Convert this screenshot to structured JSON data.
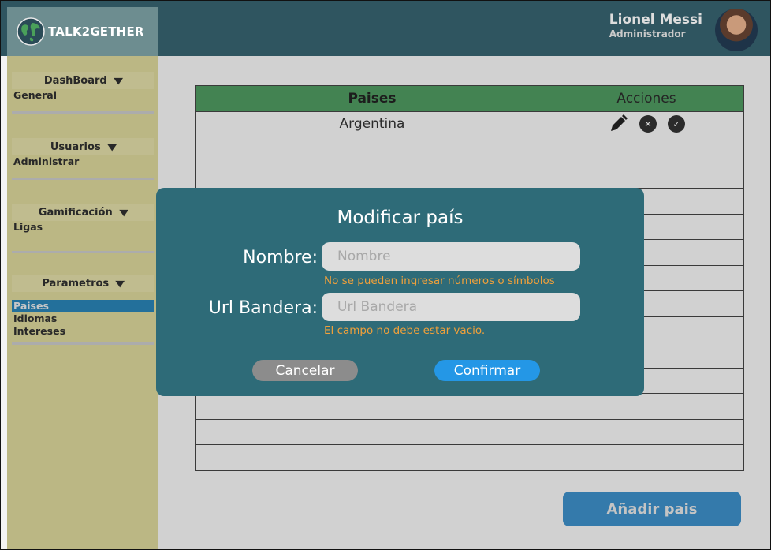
{
  "app": {
    "logo_text": "TALK2GETHER"
  },
  "user": {
    "name": "Lionel Messi",
    "role": "Administrador"
  },
  "sidebar": {
    "sections": [
      {
        "title": "DashBoard",
        "items": [
          "General"
        ]
      },
      {
        "title": "Usuarios",
        "items": [
          "Administrar"
        ]
      },
      {
        "title": "Gamificación",
        "items": [
          "Ligas"
        ]
      },
      {
        "title": "Parametros",
        "items": [
          "Paises",
          "Idiomas",
          "Intereses"
        ],
        "active": "Paises"
      }
    ]
  },
  "table": {
    "headers": [
      "Paises",
      "Acciones"
    ],
    "rows": [
      "Argentina",
      "",
      "",
      "",
      "",
      "",
      "",
      "",
      "",
      "",
      "",
      "",
      "",
      ""
    ]
  },
  "add_button": "Añadir pais",
  "modal": {
    "title": "Modificar país",
    "name_label": "Nombre:",
    "name_placeholder": "Nombre",
    "name_error": "No se pueden ingresar números o símbolos",
    "url_label": "Url Bandera:",
    "url_placeholder": "Url Bandera",
    "url_error": "El campo no debe estar vacio.",
    "cancel_label": "Cancelar",
    "confirm_label": "Confirmar"
  },
  "colors": {
    "topbar": "#2f5560",
    "modal": "#2e6b78",
    "table_header": "#4f9a61",
    "error": "#f0a03a",
    "confirm": "#2497e6"
  }
}
